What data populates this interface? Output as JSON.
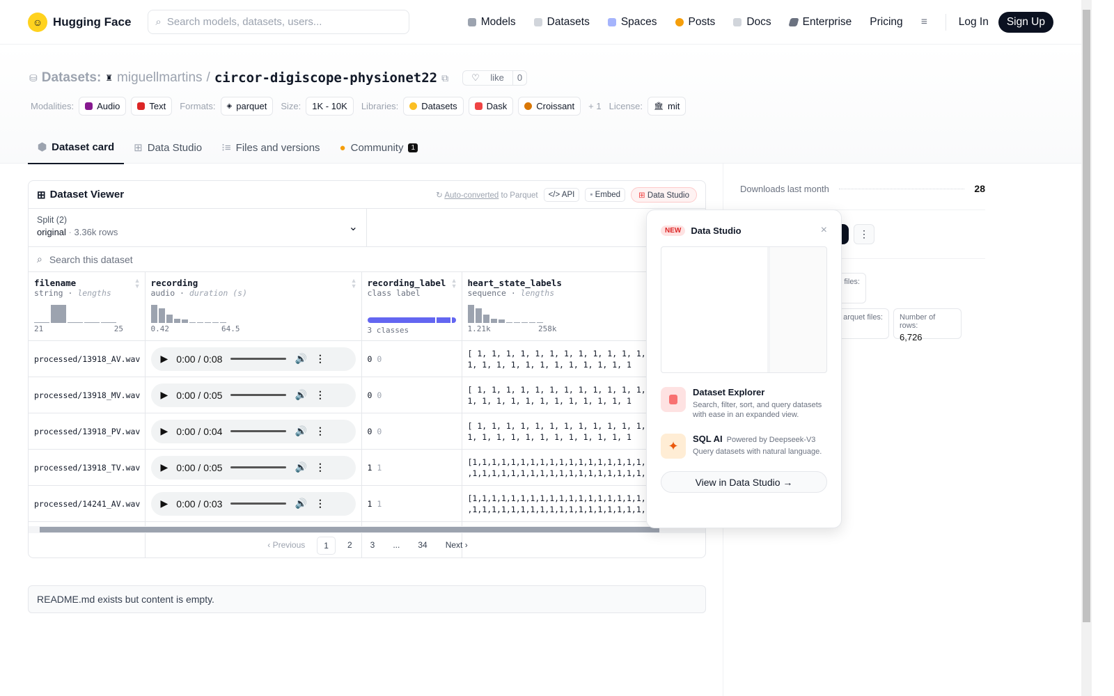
{
  "header": {
    "brand": "Hugging Face",
    "search_placeholder": "Search models, datasets, users...",
    "nav": [
      {
        "label": "Models",
        "color": "#9ca3af"
      },
      {
        "label": "Datasets",
        "color": "#d1d5db"
      },
      {
        "label": "Spaces",
        "color": "#a5b4fc"
      },
      {
        "label": "Posts",
        "color": "#f59e0b"
      },
      {
        "label": "Docs",
        "color": "#d1d5db"
      },
      {
        "label": "Enterprise",
        "color": "#6b7280"
      },
      {
        "label": "Pricing"
      }
    ],
    "login": "Log In",
    "signup": "Sign Up"
  },
  "title": {
    "section": "Datasets:",
    "owner": "miguellmartins",
    "sep": "/",
    "name": "circor-digiscope-physionet22",
    "like": "like",
    "likes": "0"
  },
  "tags": {
    "modalities_label": "Modalities:",
    "modalities": [
      "Audio",
      "Text"
    ],
    "formats_label": "Formats:",
    "format": "parquet",
    "size_label": "Size:",
    "size": "1K - 10K",
    "libraries_label": "Libraries:",
    "libraries": [
      "Datasets",
      "Dask",
      "Croissant"
    ],
    "more": "+ 1",
    "license_label": "License:",
    "license": "mit"
  },
  "tabs": [
    {
      "label": "Dataset card"
    },
    {
      "label": "Data Studio"
    },
    {
      "label": "Files and versions"
    },
    {
      "label": "Community",
      "badge": "1"
    }
  ],
  "viewer": {
    "title": "Dataset Viewer",
    "auto_link": "Auto-converted",
    "auto_rest": " to Parquet",
    "api": "API",
    "embed": "Embed",
    "data_studio": "Data Studio",
    "split_label": "Split (2)",
    "split_value": "original",
    "split_rows": "3.36k rows",
    "search_placeholder": "Search this dataset",
    "columns": [
      {
        "name": "filename",
        "type": "string",
        "stat": "lengths",
        "hist": [
          0.05,
          1,
          0.05,
          0.05,
          0.05
        ],
        "min": "21",
        "max": "25"
      },
      {
        "name": "recording",
        "type": "audio",
        "stat": "duration (s)",
        "hist": [
          1,
          0.8,
          0.45,
          0.25,
          0.2,
          0.05,
          0.05,
          0.05,
          0,
          0.05
        ],
        "min": "0.42",
        "max": "64.5"
      },
      {
        "name": "recording_label",
        "type": "class label",
        "classes": "3 classes"
      },
      {
        "name": "heart_state_labels",
        "type": "sequence",
        "stat": "lengths",
        "hist": [
          1,
          0.8,
          0.45,
          0.25,
          0.2,
          0.05,
          0.05,
          0.05,
          0,
          0.05
        ],
        "min": "1.21k",
        "max": "258k"
      }
    ],
    "rows": [
      {
        "filename": "processed/13918_AV.wav",
        "time": "0:00 / 0:08",
        "label": "0",
        "label_name": "0",
        "seq": "[ 1, 1, 1, 1, 1, 1, 1, 1, 1, 1, 1, 1,\n1, 1, 1, 1, 1, 1, 1, 1, 1, 1, 1, 1"
      },
      {
        "filename": "processed/13918_MV.wav",
        "time": "0:00 / 0:05",
        "label": "0",
        "label_name": "0",
        "seq": "[ 1, 1, 1, 1, 1, 1, 1, 1, 1, 1, 1, 1,\n1, 1, 1, 1, 1, 1, 1, 1, 1, 1, 1, 1"
      },
      {
        "filename": "processed/13918_PV.wav",
        "time": "0:00 / 0:04",
        "label": "0",
        "label_name": "0",
        "seq": "[ 1, 1, 1, 1, 1, 1, 1, 1, 1, 1, 1, 1,\n1, 1, 1, 1, 1, 1, 1, 1, 1, 1, 1, 1"
      },
      {
        "filename": "processed/13918_TV.wav",
        "time": "0:00 / 0:05",
        "label": "1",
        "label_name": "1",
        "seq": "[1,1,1,1,1,1,1,1,1,1,1,1,1,1,1,1,1,1,1\n,1,1,1,1,1,1,1,1,1,1,1,1,1,1,1,1,1,1,1"
      },
      {
        "filename": "processed/14241_AV.wav",
        "time": "0:00 / 0:03",
        "label": "1",
        "label_name": "1",
        "seq": "[1,1,1,1,1,1,1,1,1,1,1,1,1,1,1,1,1,1,1\n,1,1,1,1,1,1,1,1,1,1,1,1,1,1,1,1,1,1,1"
      }
    ],
    "pagination": {
      "prev": "‹ Previous",
      "pages": [
        "1",
        "2",
        "3",
        "...",
        "34"
      ],
      "next": "Next ›",
      "current": "1"
    }
  },
  "readme": "README.md exists but content is empty.",
  "sidebar": {
    "downloads_label": "Downloads last month",
    "downloads": "28",
    "files_label_fragment": "files:",
    "parquet_label_fragment": "arquet files:",
    "rows_label": "Number of rows:",
    "rows": "6,726"
  },
  "popup": {
    "badge": "NEW",
    "title": "Data Studio",
    "close": "×",
    "features": [
      {
        "title": "Dataset Explorer",
        "desc": "Search, filter, sort, and query datasets with ease in an expanded view."
      },
      {
        "title": "SQL AI",
        "sub": "Powered by Deepseek-V3",
        "desc": "Query datasets with natural language."
      }
    ],
    "cta": "View in Data Studio →"
  }
}
